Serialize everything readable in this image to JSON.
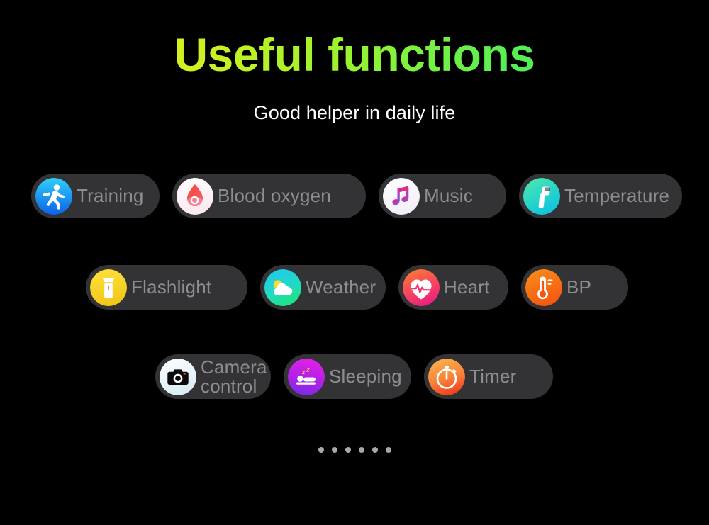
{
  "header": {
    "title": "Useful functions",
    "subtitle": "Good helper in daily life",
    "title_gradient_from": "#f5f01c",
    "title_gradient_to": "#3cec6d",
    "subtitle_color": "#ffffff"
  },
  "theme": {
    "background": "#000000",
    "pill_background": "#333336",
    "label_color": "#8d8d8d",
    "dot_color": "#a8a8a8"
  },
  "rows": [
    {
      "items": [
        {
          "label": "Training",
          "icon": "running-person-icon",
          "color": "#18b4f5"
        },
        {
          "label": "Blood oxygen",
          "icon": "blood-drop-icon",
          "color": "#f23b30"
        },
        {
          "label": "Music",
          "icon": "music-note-icon",
          "color": "#f4317f"
        },
        {
          "label": "Temperature",
          "icon": "thermometer-gun-icon",
          "color": "#2ad6b0"
        }
      ]
    },
    {
      "items": [
        {
          "label": "Flashlight",
          "icon": "flashlight-icon",
          "color": "#f5d620"
        },
        {
          "label": "Weather",
          "icon": "sun-cloud-icon",
          "color": "#25d8c0"
        },
        {
          "label": "Heart",
          "icon": "heart-rate-icon",
          "color": "#f4356c"
        },
        {
          "label": "BP",
          "icon": "thermometer-icon",
          "color": "#f96a16"
        }
      ]
    },
    {
      "items": [
        {
          "label": "Camera\ncontrol",
          "icon": "camera-icon",
          "color": "#e8f4f8"
        },
        {
          "label": "Sleeping",
          "icon": "sleeping-bed-icon",
          "color": "#b31ae0"
        },
        {
          "label": "Timer",
          "icon": "stopwatch-icon",
          "color": "#f9913a"
        }
      ]
    }
  ],
  "pagination": {
    "dots": 6,
    "active_index": 0
  }
}
